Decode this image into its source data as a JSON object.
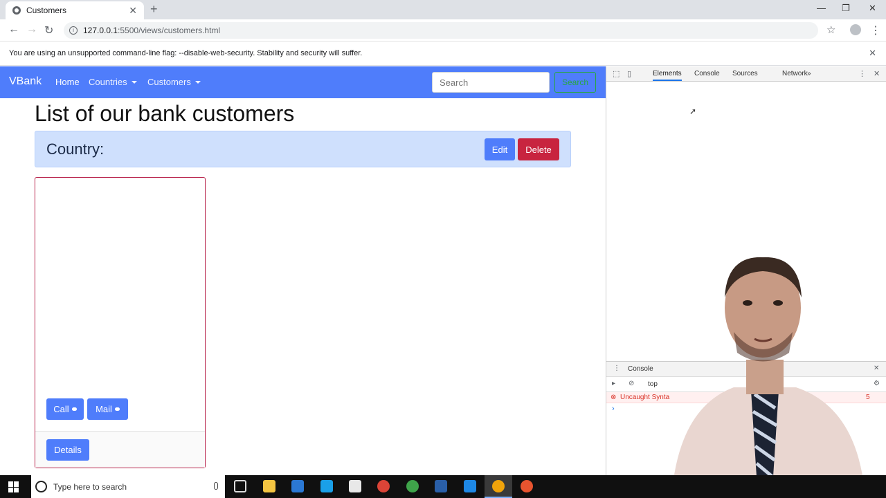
{
  "browser": {
    "tab_title": "Customers",
    "new_tab": "+",
    "tab_close": "✕",
    "url_host": "127.0.0.1",
    "url_path": ":5500/views/customers.html",
    "win_min": "—",
    "win_restore": "❐",
    "win_close": "✕",
    "back": "←",
    "forward": "→",
    "reload": "↻",
    "star": "☆",
    "menu": "⋮"
  },
  "warning": {
    "text": "You are using an unsupported command-line flag: --disable-web-security. Stability and security will suffer.",
    "close": "✕"
  },
  "navbar": {
    "brand": "VBank",
    "home": "Home",
    "countries": "Countries",
    "customers": "Customers",
    "search_placeholder": "Search",
    "search_button": "Search"
  },
  "main": {
    "title": "List of our bank customers",
    "country_label": "Country:",
    "edit": "Edit",
    "delete": "Delete"
  },
  "card": {
    "call": "Call",
    "mail": "Mail",
    "details": "Details"
  },
  "devtools": {
    "tabs": [
      "Elements",
      "Console",
      "Sources",
      "Network"
    ],
    "more": "»",
    "drawer_title": "Console",
    "context": "top",
    "error_text": "Uncaught Synta",
    "error_tail": "5",
    "prompt": "›"
  },
  "taskbar": {
    "search_text": "Type here to search"
  },
  "colors": {
    "navbar": "#4f7dfb",
    "danger": "#c8243f",
    "alert_bg": "#cfe0fd",
    "card_border": "#b8234b"
  }
}
